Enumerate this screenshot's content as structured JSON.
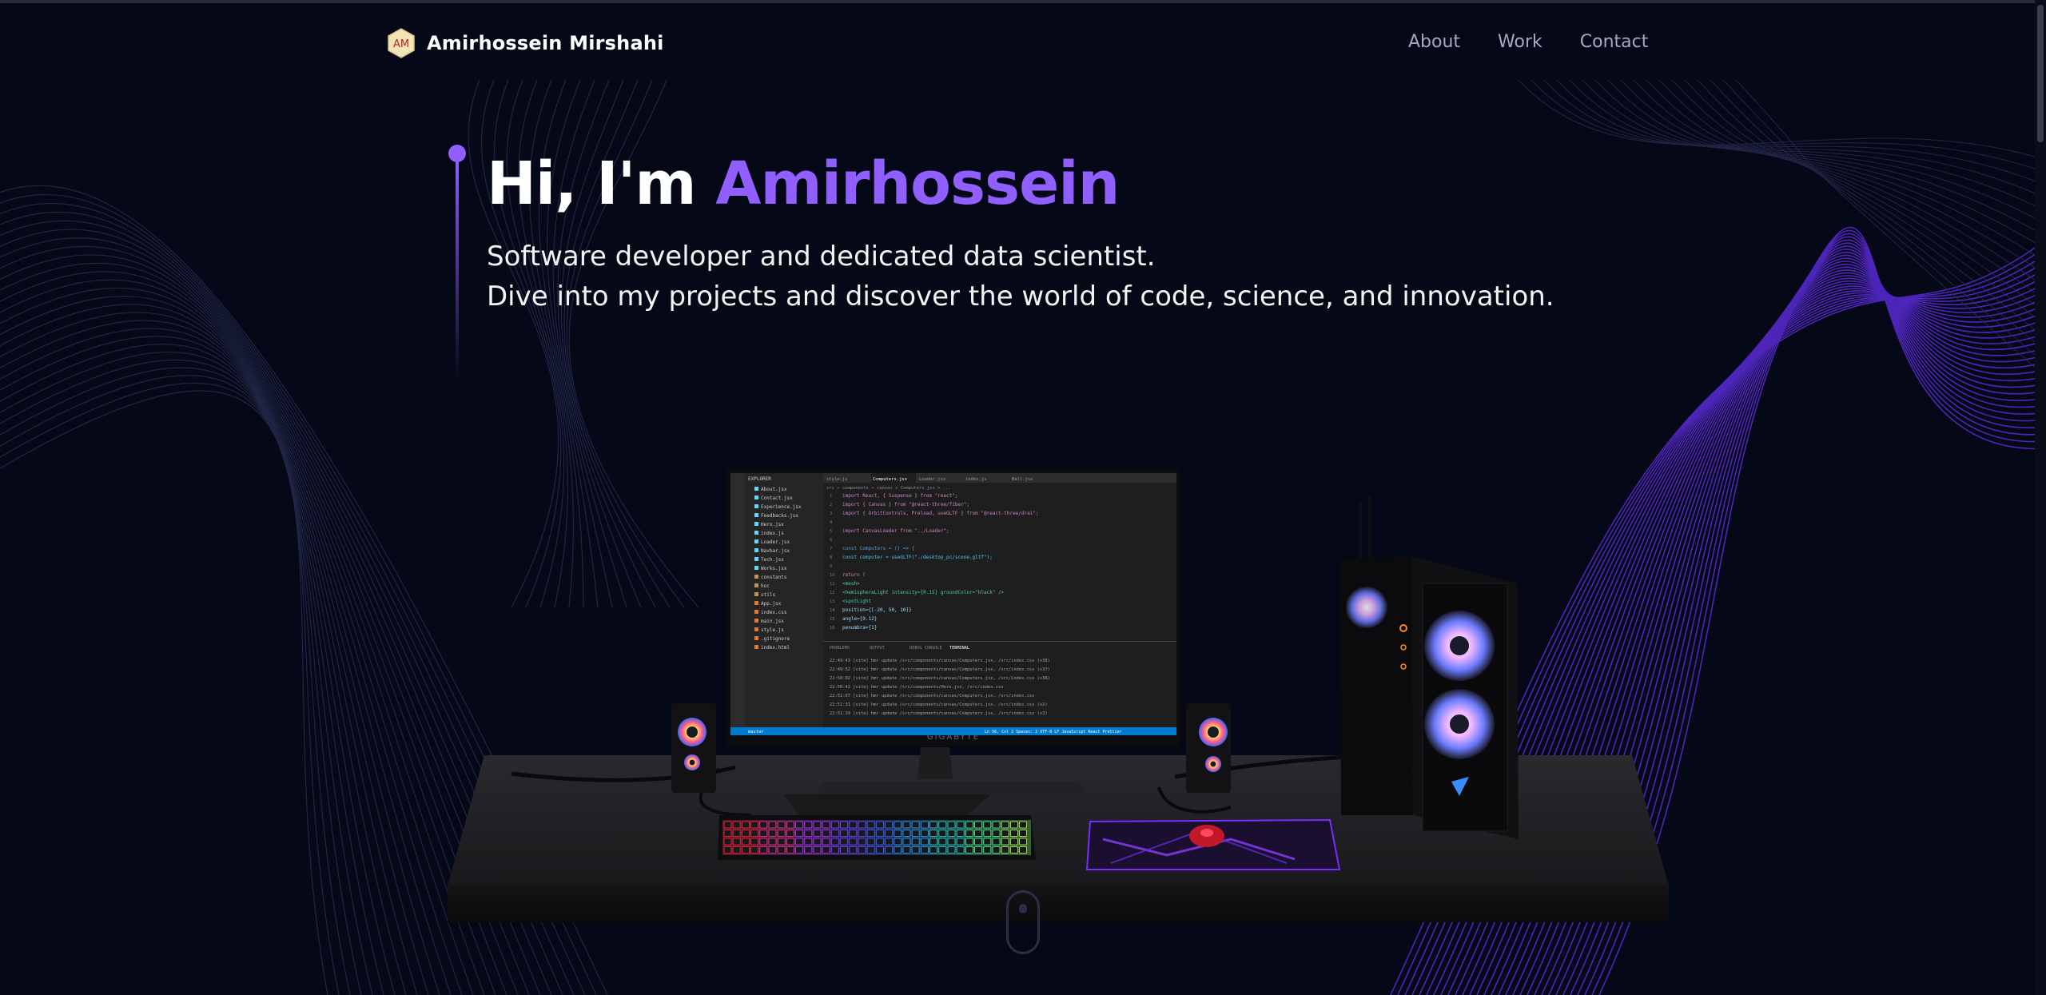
{
  "navbar": {
    "logo_initials": "AM",
    "brand_name": "Amirhossein Mirshahi",
    "links": [
      {
        "label": "About"
      },
      {
        "label": "Work"
      },
      {
        "label": "Contact"
      }
    ]
  },
  "hero": {
    "greeting": "Hi, I'm",
    "name": "Amirhossein",
    "subtitle_line1": "Software developer and dedicated data scientist.",
    "subtitle_line2": "Dive into my projects and discover the world of code, science, and innovation."
  },
  "scene": {
    "monitor_brand": "GIGABYTE",
    "editor": {
      "explorer_title": "EXPLORER",
      "tabs": [
        "style.js",
        "Computers.jsx",
        "Loader.jsx",
        "index.js",
        "Ball.jsx"
      ],
      "breadcrumb": "src > components > canvas > Computers.jsx > ...",
      "files": [
        "About.jsx",
        "Contact.jsx",
        "Experience.jsx",
        "Feedbacks.jsx",
        "Hero.jsx",
        "index.js",
        "Loader.jsx",
        "Navbar.jsx",
        "Tech.jsx",
        "Works.jsx",
        "constants",
        "hoc",
        "utils",
        "App.jsx",
        "index.css",
        "main.jsx",
        "style.js",
        ".gitignore",
        "index.html"
      ],
      "code_lines": [
        "import React, { Suspense } from \"react\";",
        "import { Canvas } from \"@react-three/fiber\";",
        "import { OrbitControls, Preload, useGLTF } from \"@react-three/drei\";",
        "",
        "import CanvasLoader from \"../Loader\";",
        "",
        "const Computers = () => {",
        "  const computer = useGLTF(\"./desktop_pc/scene.gltf\");",
        "",
        "  return (",
        "    <mesh>",
        "      <hemisphereLight intensity={0.15} groundColor=\"black\" />",
        "      <spotLight",
        "        position={[-20, 50, 10]}",
        "        angle={0.12}",
        "        penumbra={1}"
      ],
      "panel_tabs": [
        "PROBLEMS",
        "OUTPUT",
        "DEBUG CONSOLE",
        "TERMINAL"
      ],
      "terminal_lines": [
        "22:49:43 [vite] hmr update /src/components/canvas/Computers.jsx, /src/index.css (x38)",
        "22:49:52 [vite] hmr update /src/components/canvas/Computers.jsx, /src/index.css (x37)",
        "22:50:02 [vite] hmr update /src/components/canvas/Computers.jsx, /src/index.css (x38)",
        "22:50:42 [vite] hmr update /src/components/Hero.jsx, /src/index.css",
        "22:51:07 [vite] hmr update /src/components/canvas/Computers.jsx, /src/index.css",
        "22:51:31 [vite] hmr update /src/components/canvas/Computers.jsx, /src/index.css (x2)",
        "22:51:39 [vite] hmr update /src/components/canvas/Computers.jsx, /src/index.css (x3)"
      ],
      "status_left": "master",
      "status_right": "Ln 56, Col 2   Spaces: 2   UTF-8   LF   JavaScript React   Prettier"
    }
  },
  "colors": {
    "background": "#050816",
    "accent_purple": "#915eff",
    "nav_text": "#aaa6c3",
    "hero_text": "#ffffff"
  }
}
